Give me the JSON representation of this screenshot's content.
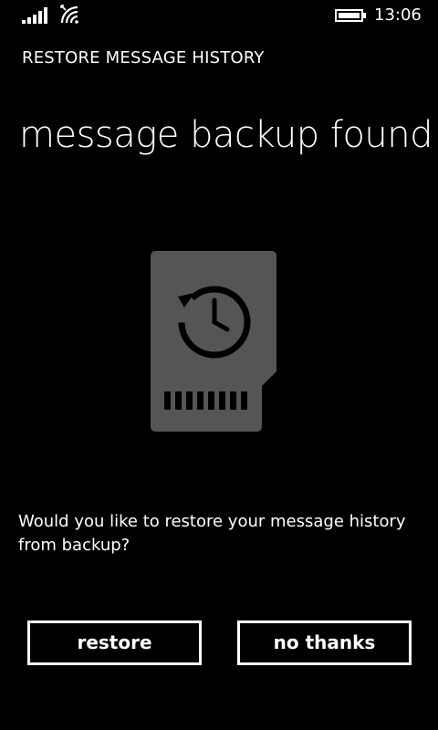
{
  "status_bar": {
    "time": "13:06",
    "icons": [
      "signal-strength-icon",
      "roaming-wifi-icon",
      "battery-icon"
    ]
  },
  "header": {
    "app_title": "RESTORE MESSAGE HISTORY",
    "page_title": "message backup found"
  },
  "illustration": {
    "icon": "sd-card-history-icon",
    "card_color": "#555555"
  },
  "body": {
    "prompt": "Would you like to restore your message history from backup?"
  },
  "actions": {
    "restore_label": "restore",
    "no_thanks_label": "no thanks"
  }
}
